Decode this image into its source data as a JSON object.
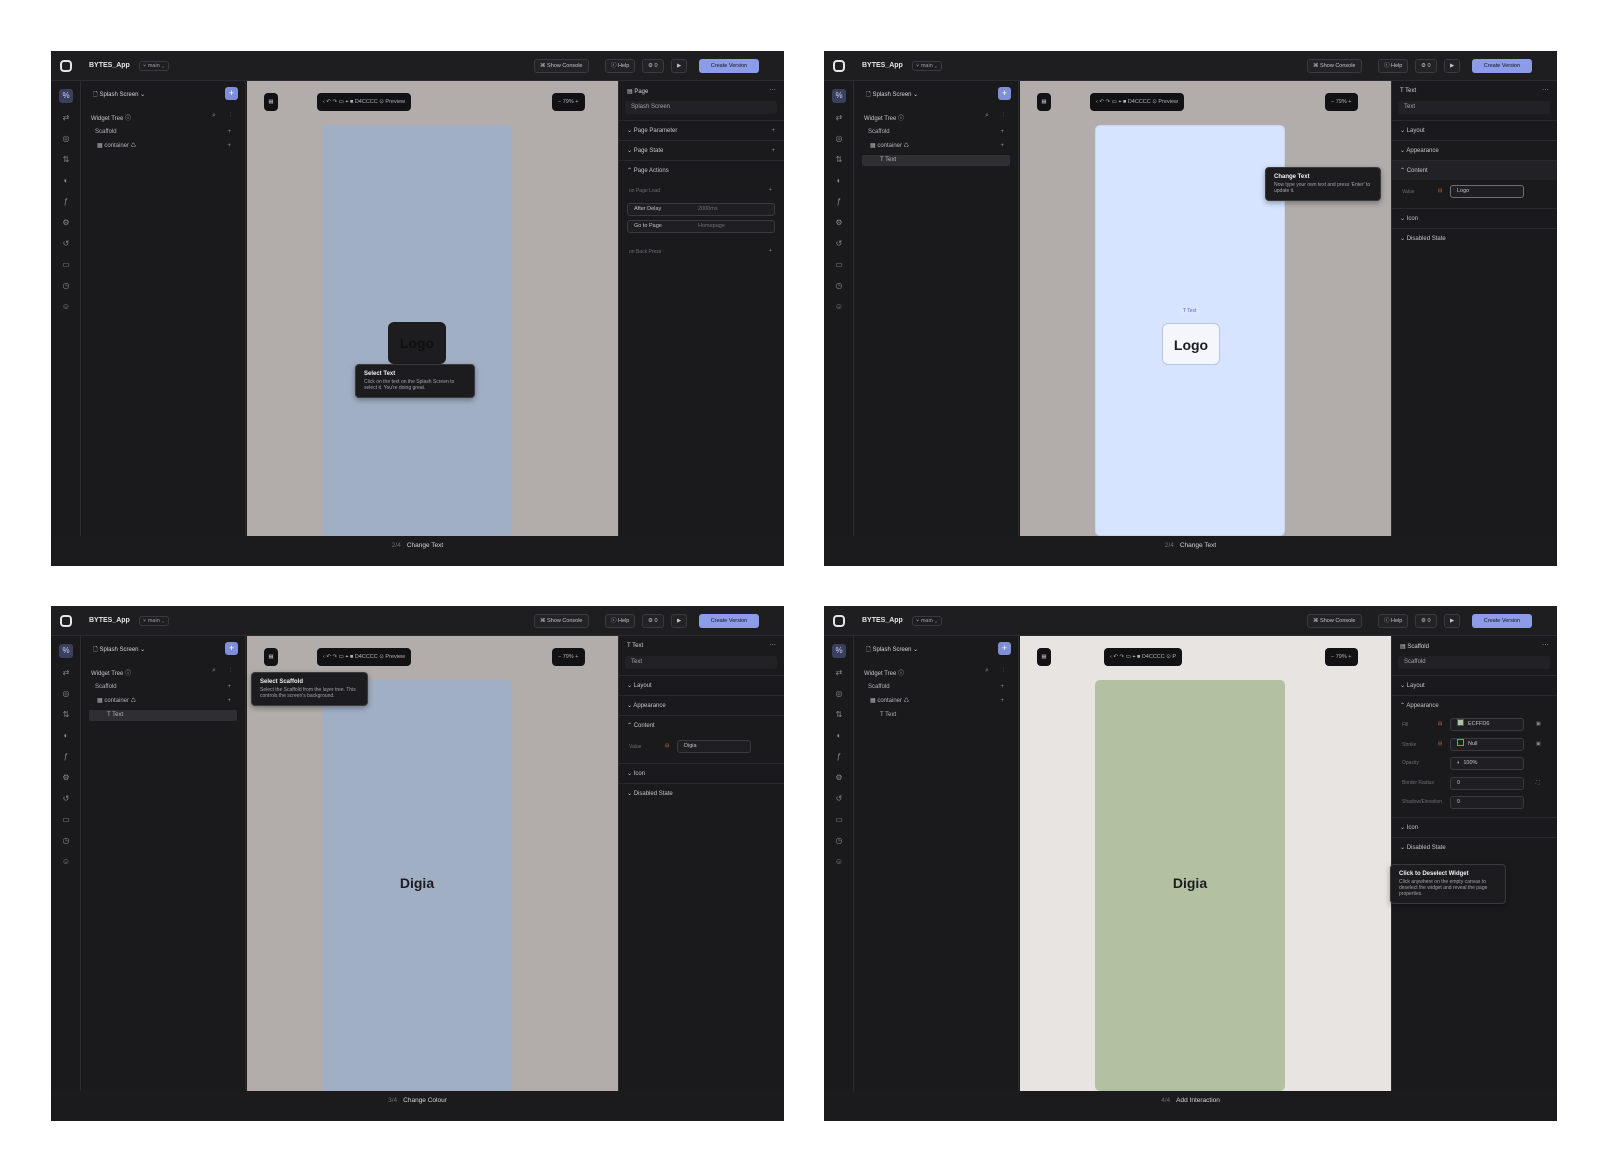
{
  "common": {
    "app_name": "BYTES_App",
    "branch": "⑂ main ⌄",
    "show_console": "⌘ Show Console",
    "help": "ⓘ Help",
    "counter": "⚙ 0",
    "play": "▶",
    "create_version": "Create Version",
    "page_selector": "🗋 Splash Screen ⌄",
    "add": "+",
    "widget_tree": "Widget Tree ⓘ",
    "tree_tools": "⌕ ⋮",
    "tree_scaffold": "Scaffold",
    "tree_container": "▦ container ♺",
    "tree_text": "T Text",
    "toolbar_main": "‹ ↶ ↷ ▭ ⌖ ■ D4CCCC ⊙ Preview",
    "toolbar_short": "‹ ↶ ↷ ▭ ⌖ ■ D4CCCC ⊙ P",
    "zoom": "−  79%  +",
    "grid_icon": "▦",
    "dots": "⋯"
  },
  "panels": [
    {
      "bottom_step": "2/4",
      "bottom_label": "Change Text",
      "canvas_logo": "Logo",
      "tooltip_title": "Select Text",
      "tooltip_body": "Click on the text on the Splash Screen to select it. You're doing great.",
      "rp_head": "▤ Page",
      "rp_name": "Splash Screen",
      "sections": [
        "⌄  Page Parameter",
        "⌄  Page State",
        "⌃  Page Actions"
      ],
      "on_page_load": "on Page Load",
      "action1_label": "After Delay",
      "action1_value": "2000ms",
      "action2_label": "Go to Page",
      "action2_value": "Homepage",
      "on_back_press": "on Back Press"
    },
    {
      "bottom_step": "2/4",
      "bottom_label": "Change Text",
      "canvas_logo": "Logo",
      "text_tag": "T Text",
      "tooltip_title": "Change Text",
      "tooltip_body": "Now type your own text and press 'Enter' to update it.",
      "rp_head": "T Text",
      "rp_name": "Text",
      "sections": [
        "⌄  Layout",
        "⌄  Appearance",
        "⌃  Content",
        "⌄  Icon",
        "⌄  Disabled State"
      ],
      "value_label": "Value",
      "value": "Logo"
    },
    {
      "bottom_step": "3/4",
      "bottom_label": "Change Colour",
      "canvas_text": "Digia",
      "tooltip_title": "Select Scaffold",
      "tooltip_body": "Select the Scaffold from the layer tree. This controls the screen's background.",
      "rp_head": "T Text",
      "rp_name": "Text",
      "sections": [
        "⌄  Layout",
        "⌄  Appearance",
        "⌃  Content",
        "⌄  Icon",
        "⌄  Disabled State"
      ],
      "value_label": "Value",
      "value": "Digia"
    },
    {
      "bottom_step": "4/4",
      "bottom_label": "Add Interaction",
      "canvas_text": "Digia",
      "tooltip_title": "Click to Deselect Widget",
      "tooltip_body": "Click anywhere on the empty canvas to deselect the widget and reveal the page properties.",
      "rp_head": "▤ Scaffold",
      "rp_name": "Scaffold",
      "sections": [
        "⌄  Layout",
        "⌃  Appearance",
        "⌄  Icon",
        "⌄  Disabled State"
      ],
      "fill_label": "Fill",
      "fill_value": "ECFFD6",
      "stroke_label": "Stroke",
      "stroke_value": "Null",
      "opacity_label": "Opacity",
      "opacity_value": "100%",
      "radius_label": "Border Radius",
      "radius_value": "0",
      "shadow_label": "Shadow/Elevation",
      "shadow_value": "0"
    }
  ],
  "colors": {
    "accent": "#8d9ce8",
    "phone_blue": "#a1afc4",
    "phone_light_blue": "#d6e4ff",
    "phone_green": "#b2c1a2",
    "canvas_grey": "#b2adab",
    "canvas_light": "#e8e4e1"
  }
}
